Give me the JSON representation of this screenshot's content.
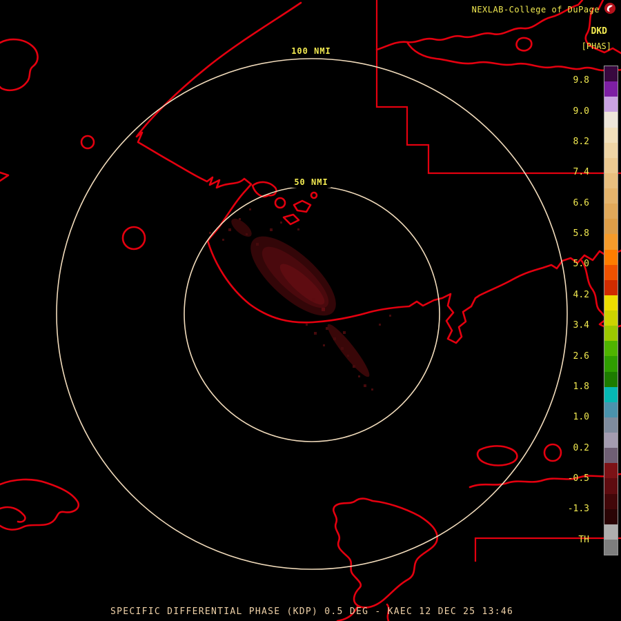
{
  "header": {
    "title": "NEXLAB-College of DuPage",
    "product_code": "DKD",
    "units": "[PHAS]",
    "logo_icon": "cod-weather-logo"
  },
  "range_rings": [
    {
      "label": "100 NMI"
    },
    {
      "label": "50 NMI"
    }
  ],
  "colorbar": {
    "tick_labels": [
      "9.8",
      "9.0",
      "8.2",
      "7.4",
      "6.6",
      "5.8",
      "5.0",
      "4.2",
      "3.4",
      "2.6",
      "1.8",
      "1.0",
      "0.2",
      "-0.5",
      "-1.3"
    ],
    "threshold_label": "TH",
    "segments": [
      "#38083f",
      "#7d1fa4",
      "#caa3e2",
      "#eee6da",
      "#f2e0bc",
      "#efd5a6",
      "#ecca92",
      "#e8bf7f",
      "#e5b46c",
      "#e1a95a",
      "#de9e48",
      "#f59b2b",
      "#fe7d00",
      "#ef5200",
      "#d02c00",
      "#eede00",
      "#cdd400",
      "#9cc800",
      "#4fb400",
      "#2f9e00",
      "#1d7c00",
      "#06b8b4",
      "#4b93ad",
      "#7f8c9e",
      "#a49cb0",
      "#6f5f74",
      "#7c1216",
      "#5e0c10",
      "#420709",
      "#2a0405",
      "#aeaeae",
      "#7e7e7e"
    ]
  },
  "footer": {
    "caption": "SPECIFIC DIFFERENTIAL PHASE (KDP) 0.5 DEG - KAEC 12 DEC 25 13:46",
    "product_name": "SPECIFIC DIFFERENTIAL PHASE",
    "product_abbrev": "KDP",
    "elevation": "0.5 DEG",
    "station": "KAEC",
    "date": "12 DEC 25",
    "time": "13:46"
  },
  "colors": {
    "background": "#000000",
    "map_outline": "#e4000f",
    "range_ring": "#f2dcbc",
    "ring_label": "#f2ea51",
    "header_text": "#f2ea51",
    "tick_text": "#f2ea51",
    "footer_text": "#f0d2a8",
    "echo_halo": "#330608",
    "echo_primary": "#4a090d",
    "echo_core": "#5e0c11"
  }
}
